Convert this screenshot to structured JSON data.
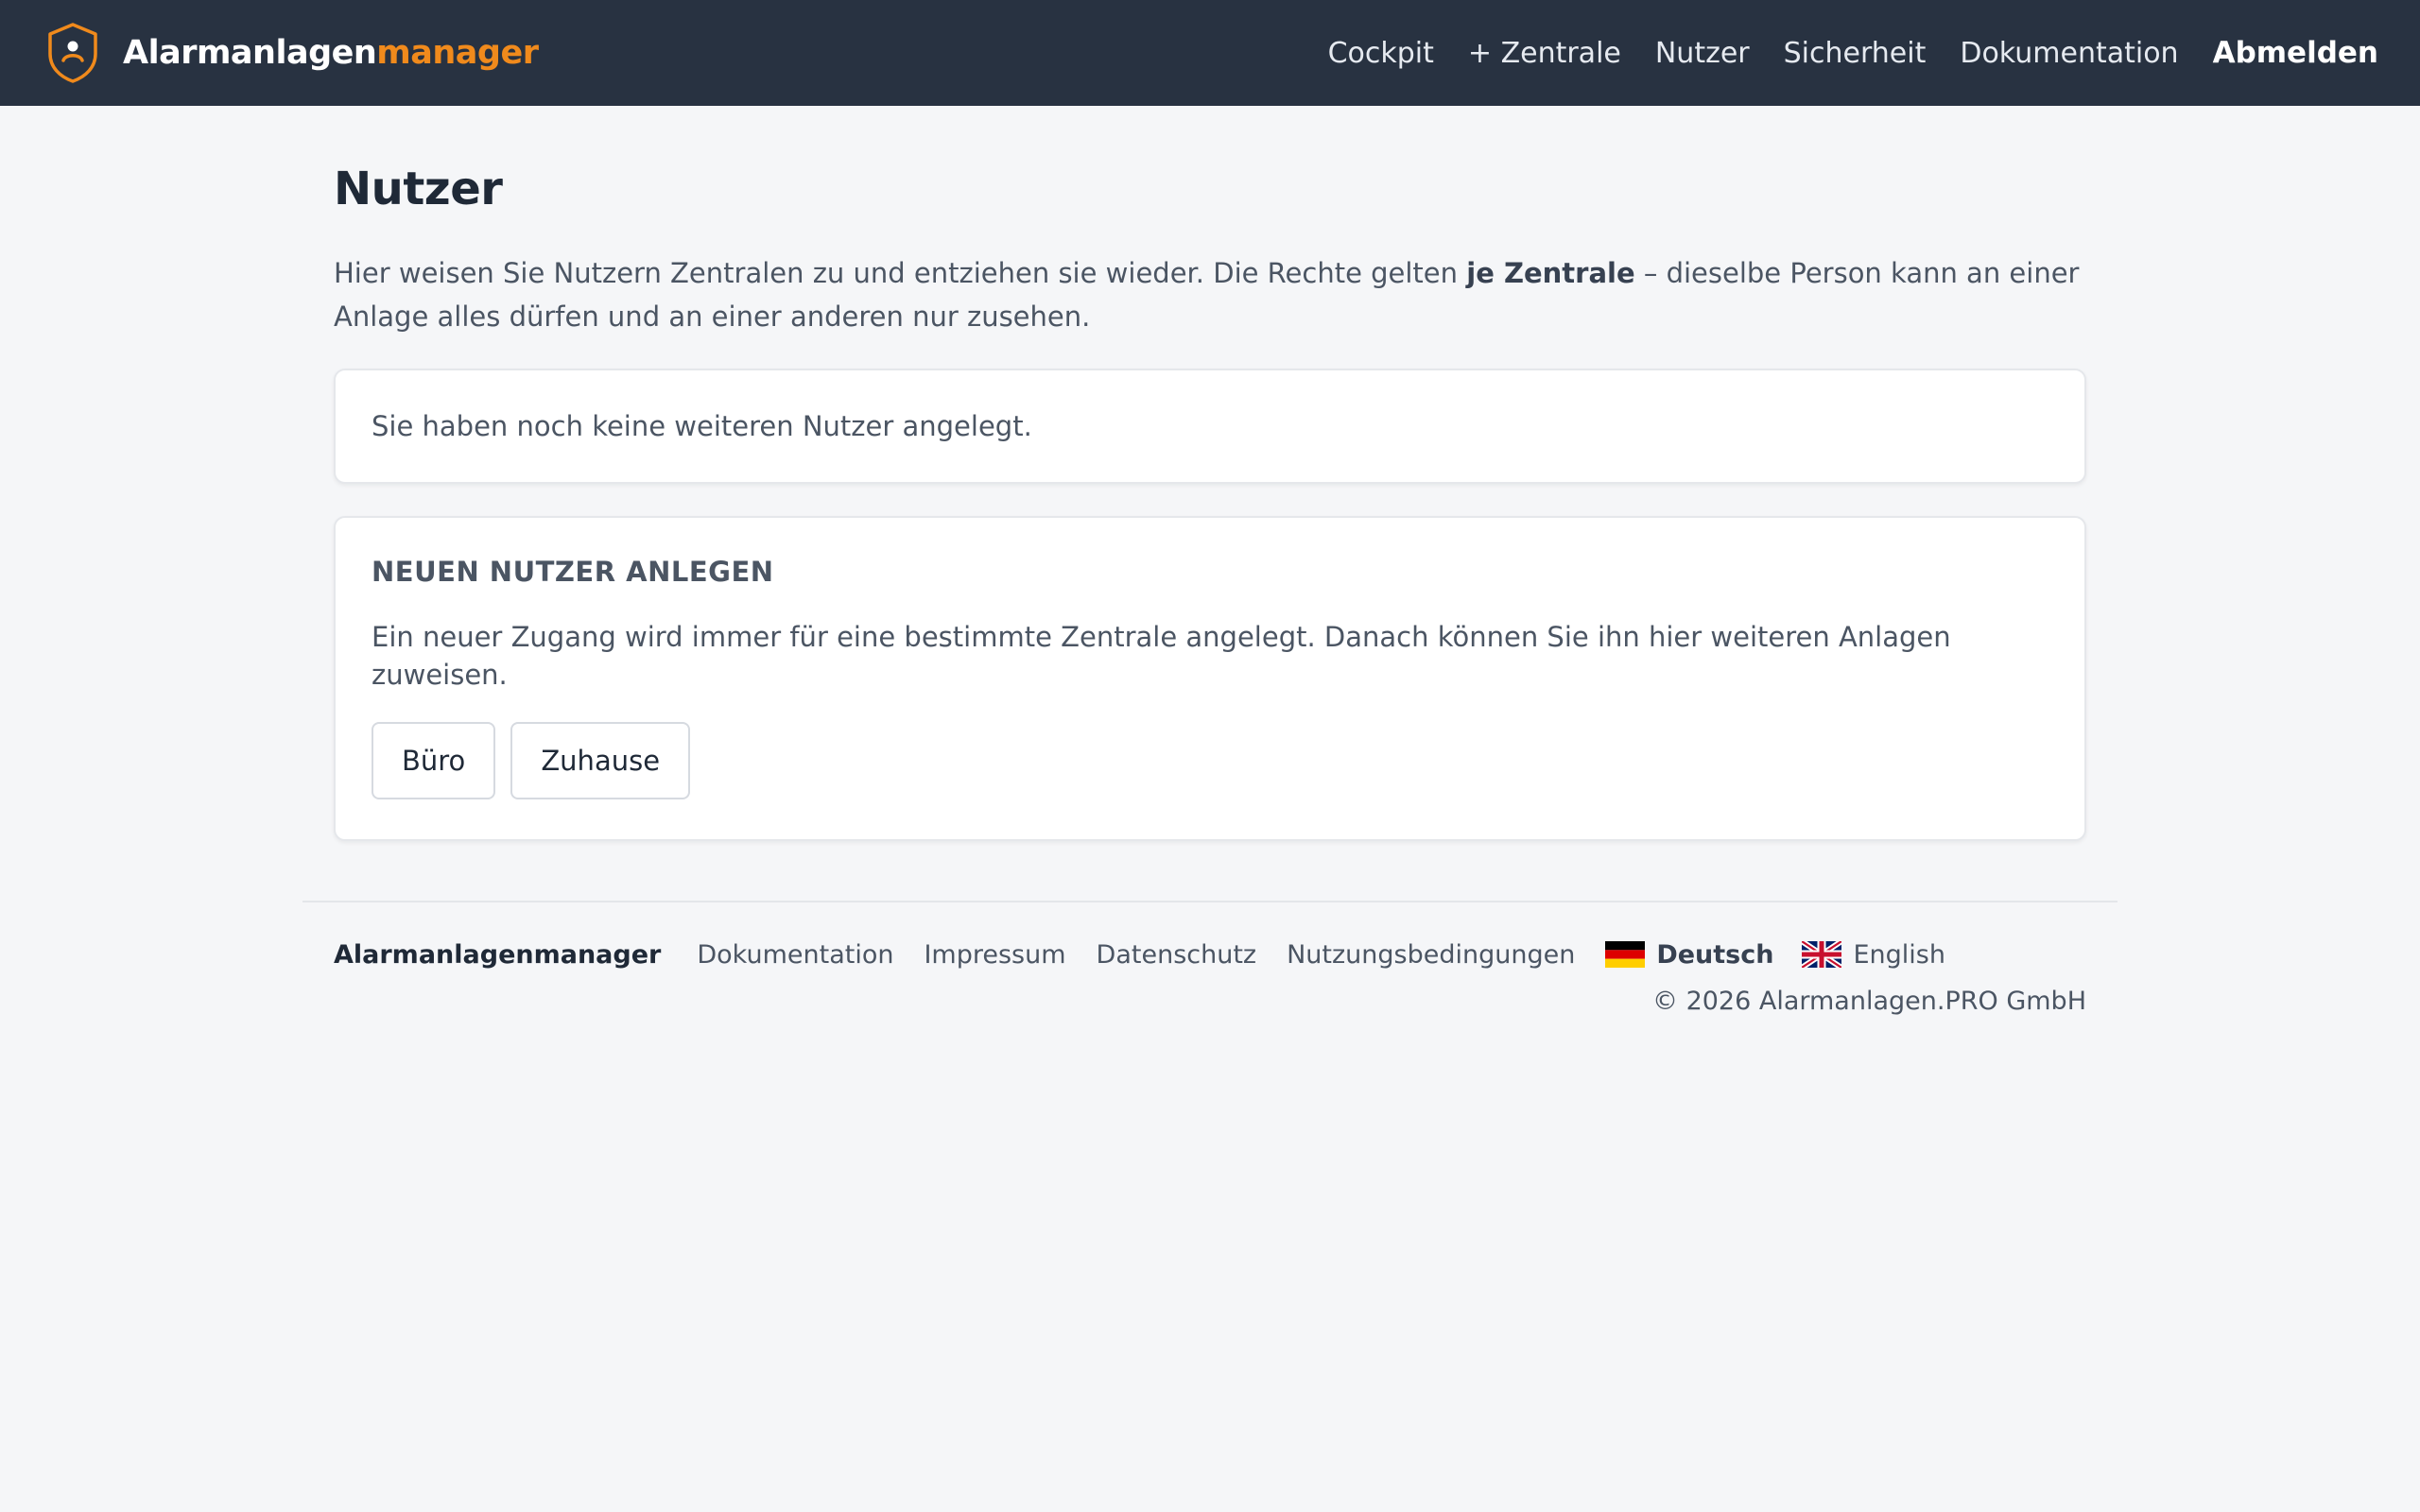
{
  "header": {
    "brand_main": "Alarmanlagen",
    "brand_accent": "manager",
    "brand_accent_color": "#f08a1c",
    "logo_icon": "shield-person-icon",
    "nav": [
      {
        "label": "Cockpit"
      },
      {
        "label": "+ Zentrale"
      },
      {
        "label": "Nutzer"
      },
      {
        "label": "Sicherheit"
      },
      {
        "label": "Dokumentation"
      }
    ],
    "logout_label": "Abmelden"
  },
  "main": {
    "title": "Nutzer",
    "intro_before": "Hier weisen Sie Nutzern Zentralen zu und entziehen sie wieder. Die Rechte gelten ",
    "intro_bold": "je Zentrale",
    "intro_after": " – dieselbe Person kann an einer Anlage alles dürfen und an einer anderen nur zusehen.",
    "empty_message": "Sie haben noch keine weiteren Nutzer angelegt.",
    "new_user": {
      "heading": "NEUEN NUTZER ANLEGEN",
      "text": "Ein neuer Zugang wird immer für eine bestimmte Zentrale angelegt. Danach können Sie ihn hier weiteren Anlagen zuweisen.",
      "buttons": [
        {
          "label": "Büro"
        },
        {
          "label": "Zuhause"
        }
      ]
    }
  },
  "footer": {
    "brand": "Alarmanlagenmanager",
    "links": [
      {
        "label": "Dokumentation"
      },
      {
        "label": "Impressum"
      },
      {
        "label": "Datenschutz"
      },
      {
        "label": "Nutzungsbedingungen"
      }
    ],
    "languages": [
      {
        "label": "Deutsch",
        "icon": "german-flag-icon",
        "active": true
      },
      {
        "label": "English",
        "icon": "uk-flag-icon",
        "active": false
      }
    ],
    "copyright": "© 2026 Alarmanlagen.PRO GmbH"
  }
}
